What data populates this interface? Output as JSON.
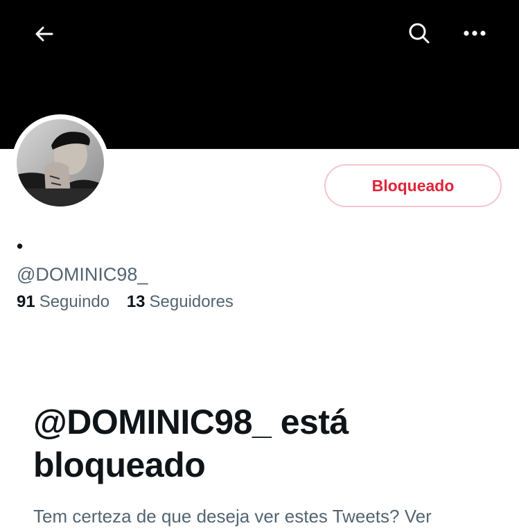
{
  "header": {
    "back_icon": "arrow-left-icon",
    "search_icon": "search-icon",
    "more_icon": "more-horizontal-icon",
    "banner_color": "#000000"
  },
  "profile": {
    "display_name": "•",
    "handle": "@DOMINIC98_",
    "following_count": "91",
    "following_label": "Seguindo",
    "followers_count": "13",
    "followers_label": "Seguidores",
    "blocked_button_label": "Bloqueado",
    "blocked_color": "#e0243a"
  },
  "blocked_notice": {
    "title": "@DOMINIC98_ está bloqueado",
    "subtitle": "Tem certeza de que deseja ver estes Tweets? Ver"
  }
}
